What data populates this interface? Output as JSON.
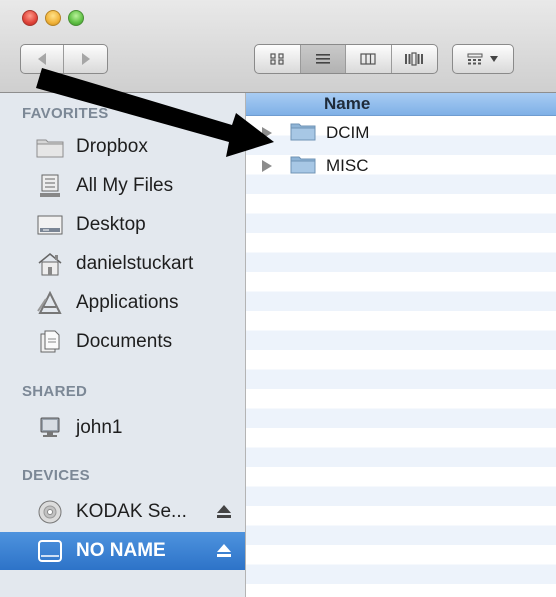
{
  "window": {
    "toolbar": {
      "nav_back_icon": "chevron-left-icon",
      "nav_forward_icon": "chevron-right-icon",
      "views": [
        "icon-view",
        "list-view",
        "column-view",
        "cover-flow-view"
      ],
      "active_view": "list-view",
      "arrange_icon": "arrange-icon"
    }
  },
  "sidebar": {
    "favorites_title": "FAVORITES",
    "favorites": [
      {
        "label": "Dropbox",
        "icon": "folder-icon"
      },
      {
        "label": "All My Files",
        "icon": "all-files-icon"
      },
      {
        "label": "Desktop",
        "icon": "desktop-icon"
      },
      {
        "label": "danielstuckart",
        "icon": "home-icon"
      },
      {
        "label": "Applications",
        "icon": "applications-icon"
      },
      {
        "label": "Documents",
        "icon": "documents-icon"
      }
    ],
    "shared_title": "SHARED",
    "shared": [
      {
        "label": "john1",
        "icon": "computer-icon"
      }
    ],
    "devices_title": "DEVICES",
    "devices": [
      {
        "label": "KODAK Se...",
        "icon": "disc-icon",
        "eject": true
      },
      {
        "label": "NO NAME",
        "icon": "drive-icon",
        "eject": true,
        "selected": true
      }
    ]
  },
  "main": {
    "column_name": "Name",
    "rows": [
      {
        "label": "DCIM",
        "icon": "folder-icon"
      },
      {
        "label": "MISC",
        "icon": "folder-icon"
      }
    ]
  },
  "colors": {
    "selection": "#2d73c8",
    "sidebar_bg": "#e3e8ee",
    "header_bg": "#a8ccf3",
    "stripe": "#edf3fb",
    "arrow": "#000000"
  }
}
